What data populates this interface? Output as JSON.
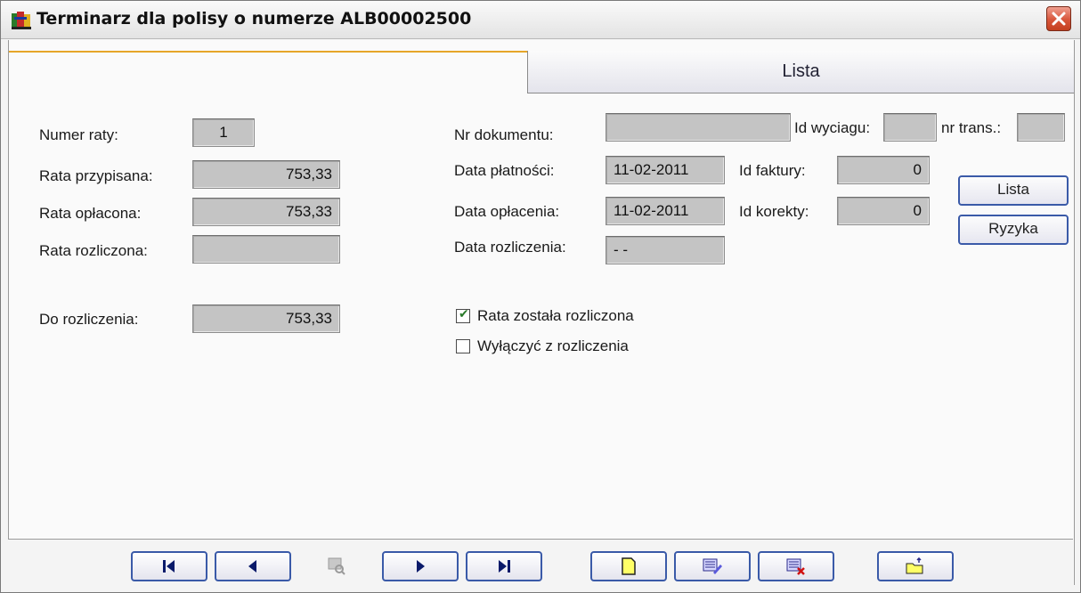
{
  "window": {
    "title": "Terminarz dla polisy o numerze ALB00002500"
  },
  "tabs": [
    {
      "label": "Lista",
      "active": true
    }
  ],
  "fields": {
    "numer_raty": {
      "label": "Numer raty:",
      "value": "1"
    },
    "rata_przypisana": {
      "label": "Rata przypisana:",
      "value": "753,33"
    },
    "rata_oplacona": {
      "label": "Rata opłacona:",
      "value": "753,33"
    },
    "rata_rozliczona": {
      "label": "Rata rozliczona:",
      "value": ""
    },
    "do_rozliczenia": {
      "label": "Do rozliczenia:",
      "value": "753,33"
    },
    "nr_dokumentu": {
      "label": "Nr dokumentu:",
      "value": ""
    },
    "id_wyciagu": {
      "label": "Id wyciagu:",
      "value": ""
    },
    "nr_trans": {
      "label": "nr trans.:",
      "value": ""
    },
    "data_platnosci": {
      "label": "Data płatności:",
      "value": "11-02-2011"
    },
    "data_oplacenia": {
      "label": "Data opłacenia:",
      "value": "11-02-2011"
    },
    "data_rozliczenia": {
      "label": "Data rozliczenia:",
      "value": "- -"
    },
    "id_faktury": {
      "label": "Id faktury:",
      "value": "0"
    },
    "id_korekty": {
      "label": "Id korekty:",
      "value": "0"
    }
  },
  "buttons": {
    "lista": "Lista",
    "ryzyka": "Ryzyka"
  },
  "checkboxes": {
    "rozliczona": {
      "label": "Rata została rozliczona",
      "checked": true
    },
    "wylaczyc": {
      "label": "Wyłączyć z rozliczenia",
      "checked": false
    }
  },
  "toolbar": [
    {
      "icon": "first-record-icon",
      "enabled": true
    },
    {
      "icon": "previous-record-icon",
      "enabled": true
    },
    {
      "icon": "find-icon",
      "enabled": false
    },
    {
      "icon": "next-record-icon",
      "enabled": true
    },
    {
      "icon": "last-record-icon",
      "enabled": true
    },
    {
      "icon": "new-record-icon",
      "enabled": true
    },
    {
      "icon": "edit-record-icon",
      "enabled": true
    },
    {
      "icon": "delete-record-icon",
      "enabled": true
    },
    {
      "icon": "open-folder-icon",
      "enabled": true
    }
  ],
  "colors": {
    "field_bg": "#c4c4c4",
    "button_border": "#3a5aa8",
    "tab_accent": "#e6a629"
  }
}
